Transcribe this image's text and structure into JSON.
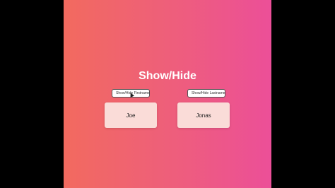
{
  "app": {
    "title": "Show/Hide"
  },
  "buttons": {
    "firstname_label": "Show/Hide Firstname",
    "lastname_label": "Show/Hide Lastname"
  },
  "cards": {
    "firstname": "Joe",
    "lastname": "Jonas"
  },
  "colors": {
    "gradient_start": "#f26a5f",
    "gradient_end": "#ec4f98",
    "card_background": "#fadcd8",
    "letterbox": "#000000"
  },
  "icons": {
    "cursor": "mouse-pointer-icon"
  }
}
